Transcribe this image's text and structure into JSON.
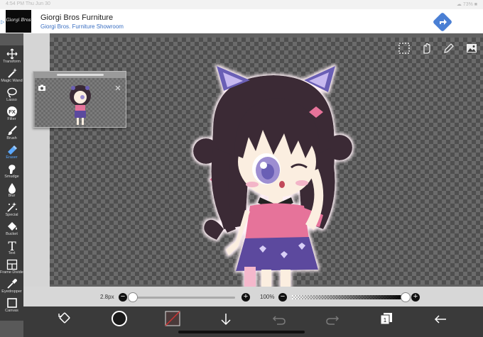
{
  "status_bar": {
    "time": "4:54 PM   Thu Jun 30",
    "right": "☁ 73%  ■"
  },
  "ad": {
    "adchoices": "▷",
    "logo_text": "Giorgi Bros",
    "brand": "Giorgi Bros Furniture",
    "tagline": "Giorgi Bros. Furniture Showroom",
    "accent": "#4a7fd4"
  },
  "toolbar": {
    "active_color": "#5aa8ff",
    "items": [
      {
        "label": "Transform",
        "icon": "move-icon"
      },
      {
        "label": "Magic Wand",
        "icon": "magic-wand-icon"
      },
      {
        "label": "Lasso",
        "icon": "lasso-icon"
      },
      {
        "label": "Filter",
        "icon": "fx-icon",
        "text": "FX"
      },
      {
        "label": "Brush",
        "icon": "brush-icon"
      },
      {
        "label": "Eraser",
        "icon": "eraser-icon",
        "active": true
      },
      {
        "label": "Smudge",
        "icon": "smudge-icon"
      },
      {
        "label": "Blur",
        "icon": "blur-drop-icon"
      },
      {
        "label": "Special",
        "icon": "special-icon"
      },
      {
        "label": "Bucket",
        "icon": "bucket-icon"
      },
      {
        "label": "Text",
        "icon": "text-icon",
        "text": "T"
      },
      {
        "label": "Frame Divider",
        "icon": "frame-divider-icon"
      },
      {
        "label": "Eyedropper",
        "icon": "eyedropper-icon"
      },
      {
        "label": "Canvas",
        "icon": "canvas-icon"
      }
    ]
  },
  "sliders": {
    "size_label": "2.8px",
    "size_fraction": 0.03,
    "opacity_label": "100%",
    "opacity_fraction": 1.0,
    "minus": "−",
    "plus": "+"
  },
  "bottom_bar": {
    "layers_count": "1",
    "brush_color": "#1a1a1a",
    "secondary_color": "#cc3333"
  },
  "colors": {
    "hair": "#3a2a35",
    "dress": "#e6739a",
    "skirt": "#5b4a9e",
    "skin": "#fbeee0",
    "ears": "#6b5fb5"
  }
}
